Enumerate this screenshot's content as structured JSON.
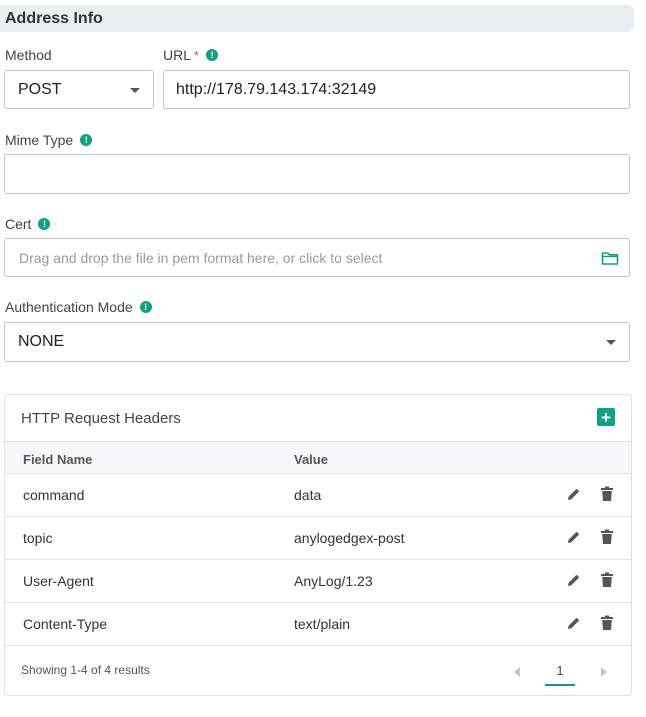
{
  "section": {
    "title": "Address Info"
  },
  "method": {
    "label": "Method",
    "value": "POST"
  },
  "url": {
    "label": "URL",
    "required_mark": "*",
    "value": "http://178.79.143.174:32149"
  },
  "mime": {
    "label": "Mime Type",
    "value": ""
  },
  "cert": {
    "label": "Cert",
    "placeholder": "Drag and drop the file in pem format here, or click to select"
  },
  "auth": {
    "label": "Authentication Mode",
    "value": "NONE"
  },
  "info_icon_glyph": "!",
  "headers_table": {
    "title": "HTTP Request Headers",
    "add_glyph": "+",
    "columns": [
      "Field Name",
      "Value"
    ],
    "rows": [
      {
        "field": "command",
        "value": "data"
      },
      {
        "field": "topic",
        "value": "anylogedgex-post"
      },
      {
        "field": "User-Agent",
        "value": "AnyLog/1.23"
      },
      {
        "field": "Content-Type",
        "value": "text/plain"
      }
    ],
    "summary": "Showing 1-4 of 4 results",
    "page": "1"
  },
  "colors": {
    "accent": "#12a085",
    "required": "#e0443e",
    "header_bg": "#e9eef1"
  },
  "icons": [
    "info-icon",
    "folder-icon",
    "add-icon",
    "edit-icon",
    "delete-icon",
    "chevron-left-icon",
    "chevron-right-icon",
    "caret-down-icon"
  ]
}
